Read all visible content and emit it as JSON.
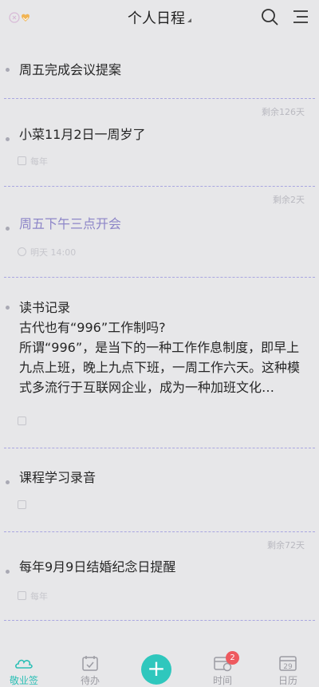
{
  "header": {
    "title": "个人日程"
  },
  "items": [
    {
      "text": "周五完成会议提案",
      "meta": "",
      "remain": "剩余126天"
    },
    {
      "text": "小菜11月2日一周岁了",
      "meta": "每年",
      "remain": "剩余2天"
    },
    {
      "text": "周五下午三点开会",
      "meta": "明天 14:00",
      "remain": ""
    },
    {
      "text": "读书记录",
      "text2": "古代也有“996”工作制吗?",
      "text3": "所谓“996”，是当下的一种工作作息制度，即早上九点上班，晚上九点下班，一周工作六天。这种模式多流行于互联网企业，成为一种加班文化…",
      "meta": "",
      "remain": ""
    },
    {
      "text": "课程学习录音",
      "meta": "",
      "remain": "剩余72天"
    },
    {
      "text": "每年9月9日结婚纪念日提醒",
      "meta": "每年",
      "remain": ""
    }
  ],
  "tabs": [
    {
      "label": "敬业签",
      "icon": "cloud-icon"
    },
    {
      "label": "待办",
      "icon": "calendar-check-icon"
    },
    {
      "label": "",
      "icon": "plus-icon"
    },
    {
      "label": "时间",
      "icon": "calendar-clock-icon",
      "badge": "2"
    },
    {
      "label": "日历",
      "icon": "calendar-29-icon",
      "day": "29"
    }
  ],
  "colors": {
    "accent": "#2fc7bd",
    "divider": "#a9a6e0",
    "badge": "#ee5a5f",
    "highlight_text": "#8d86c8"
  }
}
